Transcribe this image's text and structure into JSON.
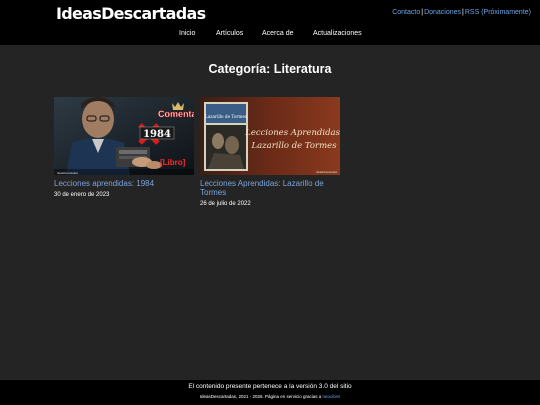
{
  "header": {
    "logo": "IdeasDescartadas",
    "top_links": {
      "contact": "Contacto",
      "donations": "Donaciones",
      "rss": "RSS (Próximamente)",
      "sep": "|"
    },
    "nav": [
      "Inicio",
      "Artículos",
      "Acerca de",
      "Actualizaciones"
    ]
  },
  "main": {
    "title": "Categoría: Literatura",
    "posts": [
      {
        "title": "Lecciones aprendidas: 1984",
        "date": "30 de enero de 2023",
        "thumb": {
          "caption_top": "Comentario:",
          "number": "1984",
          "tag": "[Libro]",
          "credit": "IdeasDescartadas"
        }
      },
      {
        "title": "Lecciones Aprendidas: Lazarillo de Tormes",
        "date": "26 de julio de 2022",
        "thumb": {
          "book_title": "Lazarillo de Tormes",
          "script_line1": "Lecciones Aprendidas:",
          "script_line2": "Lazarillo de Tormes",
          "credit": "IdeasDescartadas"
        }
      }
    ]
  },
  "footer": {
    "line1": "El contenido presente pertenece a la versión 3.0 del sitio",
    "line2_prefix": "IdeasDescartadas, 2021 - 2026. Página en servicio gracias a ",
    "line2_link": "neocities"
  },
  "colors": {
    "background": "#242424",
    "header_bg": "#000000",
    "link_blue": "#6aa5e6",
    "post_title_blue": "#79a4de"
  }
}
